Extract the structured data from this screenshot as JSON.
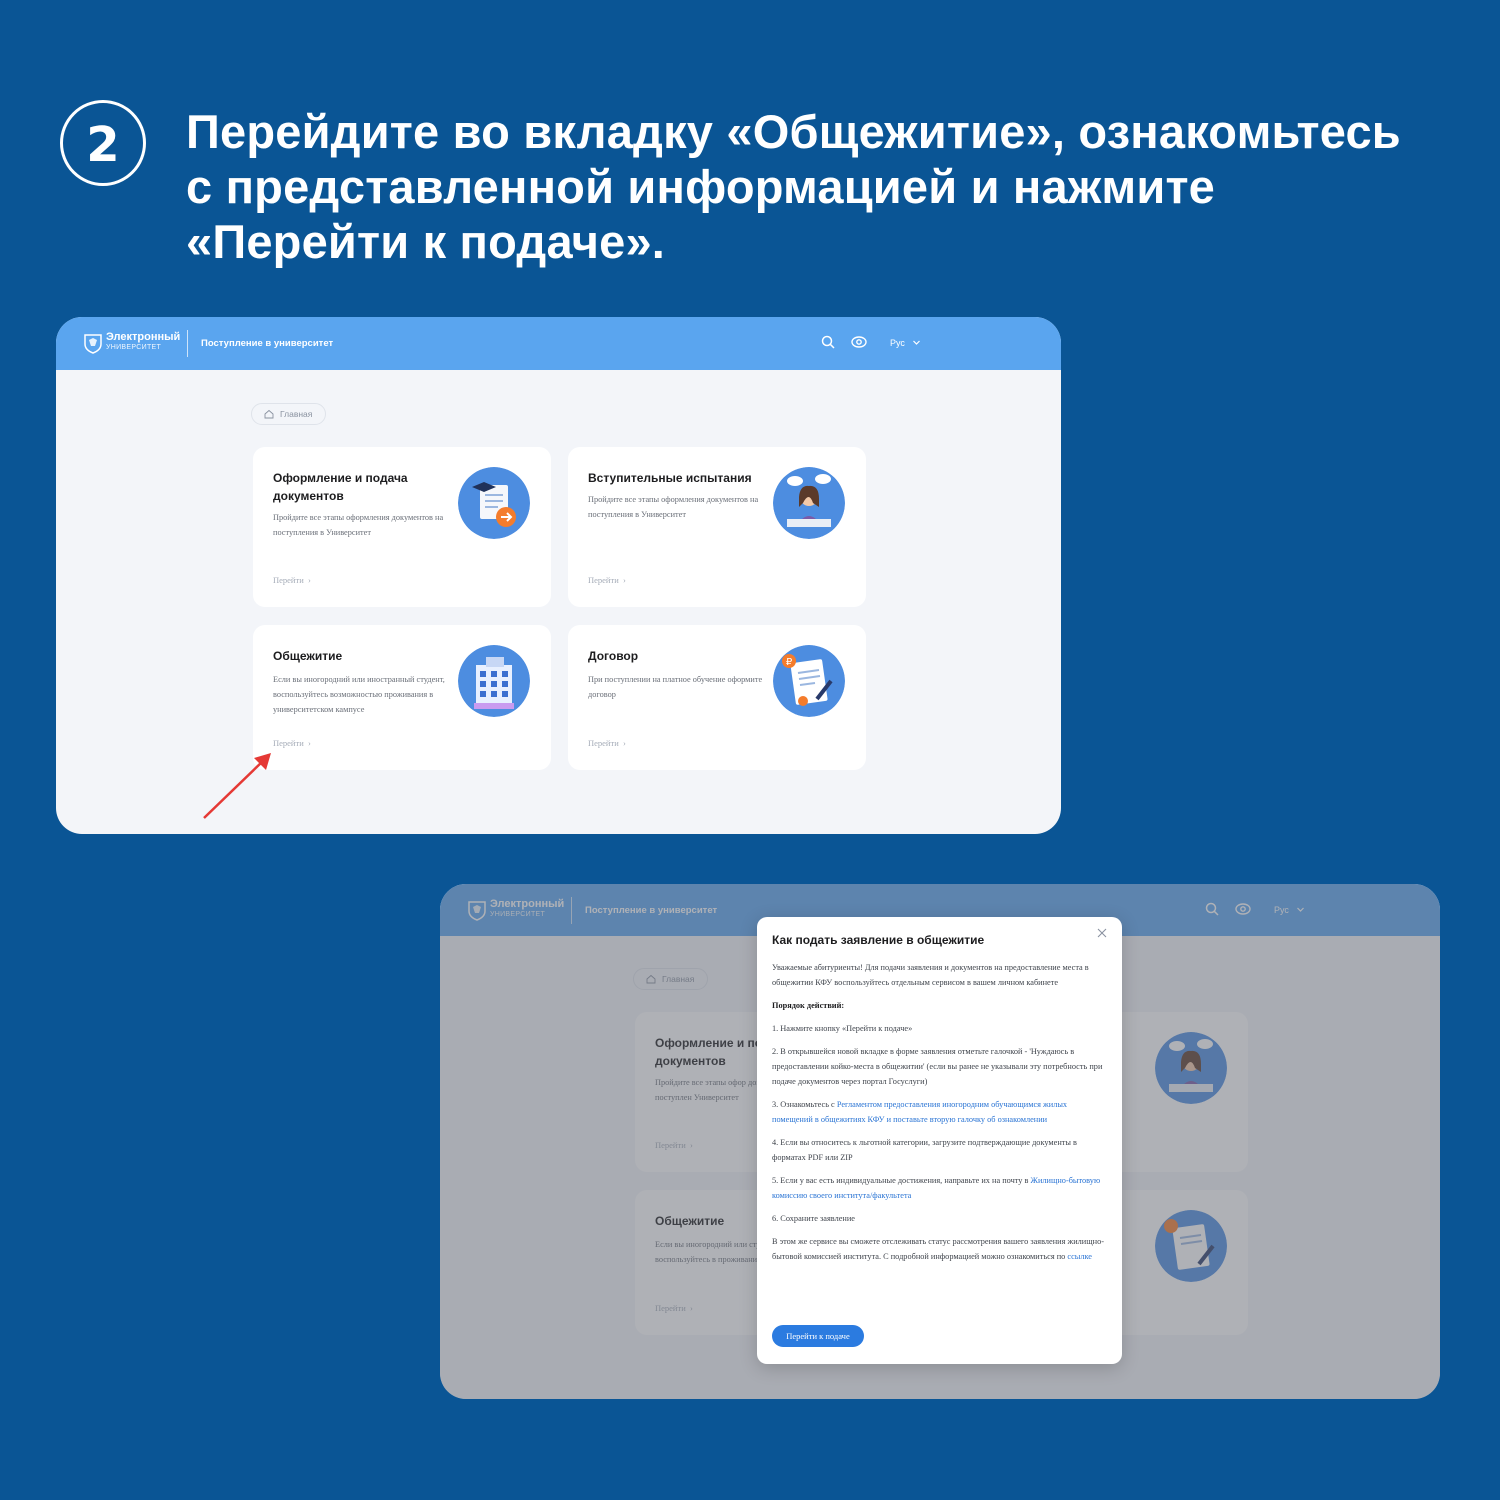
{
  "step": {
    "number": "2"
  },
  "headline": {
    "line1": "Перейдите во вкладку «Общежитие», ознакомьтесь",
    "line2": "с представленной информацией и нажмите",
    "line3": "«Перейти к подаче»."
  },
  "app": {
    "logo_line1": "Электронный",
    "logo_line2": "УНИВЕРСИТЕТ",
    "section_title": "Поступление в университет",
    "language": "Рус",
    "breadcrumb_home": "Главная"
  },
  "cards": [
    {
      "title": "Оформление и подача документов",
      "desc": "Пройдите все этапы оформления документов на поступления в Университет",
      "link": "Перейти",
      "icon": "document-cap-icon"
    },
    {
      "title": "Вступительные испытания",
      "desc": "Пройдите все этапы оформления документов на поступления в Университет",
      "link": "Перейти",
      "icon": "student-writing-icon"
    },
    {
      "title": "Общежитие",
      "desc": "Если вы иногородний или иностранный студент, воспользуйтесь возможностью проживания в университетском кампусе",
      "link": "Перейти",
      "icon": "building-icon"
    },
    {
      "title": "Договор",
      "desc": "При поступлении на платное обучение оформите договор",
      "link": "Перейти",
      "icon": "contract-icon"
    }
  ],
  "bg_cards": [
    {
      "title": "Оформление и по документов",
      "desc": "Пройдите все этапы офор документов на поступлен Университет",
      "link": "Перейти"
    },
    {
      "title": "Общежитие",
      "desc": "Если вы иногородний или студент, воспользуйтесь в проживания в университе",
      "link": "Перейти"
    }
  ],
  "modal": {
    "title": "Как подать заявление в общежитие",
    "intro": "Уважаемые абитуриенты! Для подачи заявления и документов на предоставление места в общежитии КФУ воспользуйтесь отдельным сервисом в вашем личном кабинете",
    "steps_header": "Порядок действий:",
    "step1": "1. Нажмите кнопку «Перейти к подаче»",
    "step2": "2. В открывшейся новой вкладке в форме заявления отметьте галочкой - 'Нуждаюсь в предоставлении койко-места в общежитии' (если вы ранее не указывали эту потребность при подаче документов через портал Госуслуги)",
    "step3_prefix": "3. Ознакомьтесь с ",
    "step3_link": "Регламентом предоставления иногородним обучающимся жилых помещений в общежитиях КФУ и поставьте вторую галочку об ознакомлении",
    "step4": "4. Если вы относитесь к льготной категории, загрузите подтверждающие документы в форматах PDF или ZIP",
    "step5_prefix": "5. Если у вас есть индивидуальные достижения, направьте их на почту в ",
    "step5_link": "Жилищно-бытовую комиссию своего института/факультета",
    "step6": "6. Сохраните заявление",
    "outro_prefix": "В этом же сервисе вы сможете отслеживать статус рассмотрения вашего заявления жилищно-бытовой комиссией института. С подробной информацией можно ознакомиться по ",
    "outro_link": "ссылке",
    "button": "Перейти к подаче"
  },
  "colors": {
    "background": "#0a5595",
    "topbar": "#5aa5ef",
    "link": "#2a74d4",
    "button": "#2b7be0",
    "arrow": "#e53935"
  }
}
